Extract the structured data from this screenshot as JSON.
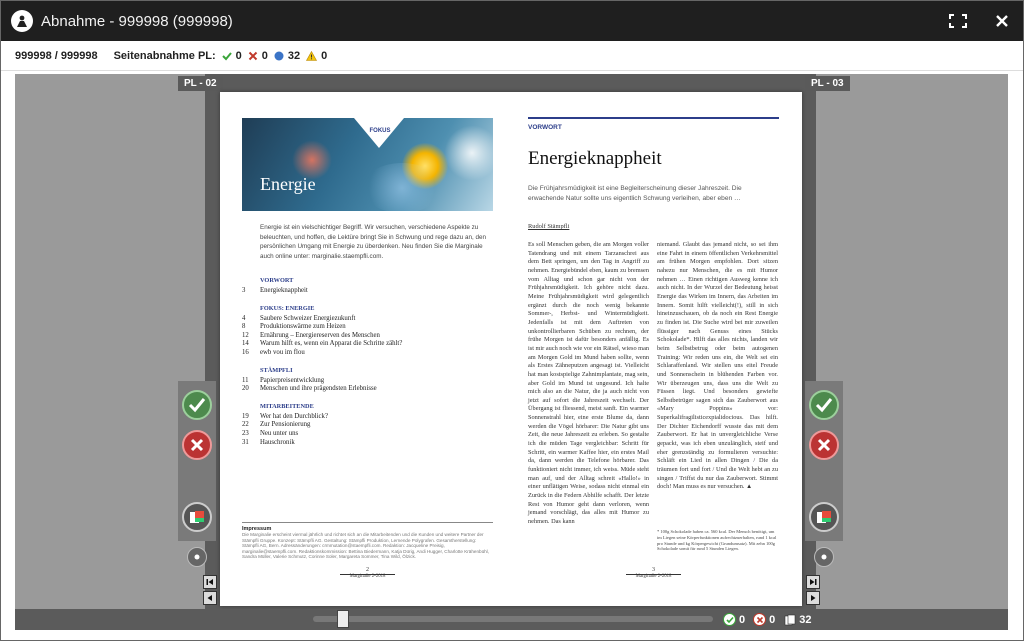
{
  "window": {
    "title": "Abnahme - 999998 (999998)"
  },
  "infobar": {
    "job_id": "999998 / 999998",
    "label": "Seitenabnahme PL:",
    "approved_count": "0",
    "rejected_count": "0",
    "pending_count": "32",
    "warning_count": "0"
  },
  "viewer": {
    "left_page_label": "PL - 02",
    "right_page_label": "PL - 03"
  },
  "bottombar": {
    "approved_count": "0",
    "rejected_count": "0",
    "pages_count": "32"
  },
  "colors": {
    "titlebar": "#1f1f1f",
    "approve_green": "#4caf50",
    "reject_red": "#d9534f",
    "accent_blue": "#2c3e8a"
  },
  "left_page": {
    "hero_tag": "FOKUS",
    "hero_title": "Energie",
    "intro": "Energie ist ein vielschichtiger Begriff. Wir versuchen, verschiedene Aspekte zu beleuchten, und hoffen, die Lektüre bringt Sie in Schwung und rege dazu an, den persönlichen Umgang mit Energie zu überdenken. Neu finden Sie die Marginale auch online unter: marginalie.staempfli.com.",
    "toc": [
      {
        "section": "VORWORT",
        "rows": [
          {
            "num": "3",
            "text": "Energieknappheit"
          }
        ]
      },
      {
        "section": "FOKUS: ENERGIE",
        "rows": [
          {
            "num": "4",
            "text": "Saubere Schweizer Energiezukunft"
          },
          {
            "num": "8",
            "text": "Produktionswärme zum Heizen"
          },
          {
            "num": "12",
            "text": "Ernährung – Energiereserven des Menschen"
          },
          {
            "num": "14",
            "text": "Warum hilft es, wenn ein Apparat die Schritte zählt?"
          },
          {
            "num": "16",
            "text": "ewb vou im flou"
          }
        ]
      },
      {
        "section": "STÄMPFLI",
        "rows": [
          {
            "num": "11",
            "text": "Papierpreisentwicklung"
          },
          {
            "num": "20",
            "text": "Menschen und ihre prägendsten Erlebnisse"
          }
        ]
      },
      {
        "section": "MITARBEITENDE",
        "rows": [
          {
            "num": "19",
            "text": "Wer hat den Durchblick?"
          },
          {
            "num": "22",
            "text": "Zur Pensionierung"
          },
          {
            "num": "23",
            "text": "Neu unter uns"
          },
          {
            "num": "31",
            "text": "Hauschronik"
          }
        ]
      }
    ],
    "impressum_title": "Impressum",
    "impressum_text": "Die Marginalie erscheint viermal jährlich und richtet sich an die Mitarbeitenden und die Kunden und weitere Partner der Stämpfli Gruppe. Konzept: Stämpfli AG. Gestaltung: Stämpfli Produktion, Lernende Polygrafen. Gesamtherstellung: Stämpfli AG, Bern. Adressänderungen: crmmutation@staempfli.com. Redaktion: Jacqueline Preisig, marginalie@staempfli.com. Redaktionskommission: Bettina Biedermann, Katja Dürig, Andi Hugger, Charlotte Krähenbühl, Sandra Müller, Valerie Schmutz, Corinne Soler, Margareta Sommer, Tina Wild, Ölzick.",
    "folio_num": "2",
    "folio_text": "Marginalie 2•2018"
  },
  "right_page": {
    "kicker": "VORWORT",
    "headline": "Energieknappheit",
    "lead": "Die Frühjahrsmüdigkeit ist eine Begleiterscheinung dieser Jahreszeit. Die erwachende Natur sollte uns eigentlich Schwung verleihen, aber eben …",
    "author": "Rudolf Stämpfli",
    "col1": "Es soll Menschen geben, die am Morgen voller Tatendrang und mit einem Tarzanschrei aus dem Bett springen, um den Tag in Angriff zu nehmen. Energiebündel eben, kaum zu bremsen vom Alltag und schon gar nicht von der Frühjahrsmüdigkeit. Ich gehöre nicht dazu. Meine Frühjahrsmüdigkeit wird gelegentlich ergänzt durch die noch wenig bekannte Sommer-, Herbst- und Wintermüdigkeit. Jedenfalls ist mit dem Auftreten von unkontrollierbaren Schüben zu rechnen, der frühe Morgen ist dafür besonders anfällig. Es ist mir auch noch wie vor ein Rätsel, wieso man am Morgen Gold im Mund haben sollte, wenn als Erstes Zähneputzen angesagt ist. Vielleicht hat man kostspielige Zahnimplantate, mag sein, aber Gold im Mund ist ungesund. Ich halte mich also an die Natur, die ja auch nicht von jetzt auf sofort die Jahreszeit wechselt. Der Übergang ist fliessend, meist sanft. Ein warmer Sonnenstrahl hier, eine erste Blume da, dann werden die Vögel hörbarer: Die Natur gibt uns Zeit, die neue Jahreszeit zu erleben. So gestalte ich die müden Tage vergleichbar: Schritt für Schritt, ein warmer Kaffee hier, ein erstes Mail da, dann werden die Telefone hörbarer. Das funktioniert nicht immer, ich weiss. Müde steht man auf, und der Alltag schreit «Hallo!» in einer unflätigen Weise, sodass nicht einmal ein Zurück in die Federn Abhilfe schafft. Der letzte Rest von Humor geht dann verloren, wenn jemand vorschlägt, das alles mit Humor zu nehmen. Das kann",
    "col2": "niemand. Glaubt das jemand nicht, so sei ihm eine Fahrt in einem öffentlichen Verkehrsmittel am frühen Morgen empfohlen. Dort sitzen nahezu nur Menschen, die es mit Humor nehmen … Einen richtigen Ausweg kenne ich auch nicht. In der Wurzel der Bedeutung heisst Energie das Wirken im Innern, das Arbeiten im Innern. Somit hilft vielleicht(!), still in sich hineinzuschauen, ob da noch ein Rest Energie zu finden ist. Die Suche wird bei mir zuweilen flüssiger nach Genuss eines Stücks Schokolade*. Hilft das alles nichts, landen wir beim Selbstbetrug oder beim autogenen Training: Wir reden uns ein, die Welt sei ein Schlaraffenland. Wir stellen uns eitel Freude und Sonnenschein in blühenden Farben vor. Wir überzeugen uns, dass uns die Welt zu Füssen liegt. Und besonders gewiefte Selbstbetrüger sagen sich das Zauberwort aus «Mary Poppins» vor: Superkalifragilisticexpialidocious. Das hilft. Der Dichter Eichendorff wusste das mit dem Zauberwort. Er hat in unvergleichliche Verse gepackt, was ich eben unzulänglich, steif und eher grenzständig zu formulieren versuchte: Schläft ein Lied in allen Dingen / Die da träumen fort und fort / Und die Welt hebt an zu singen / Triffst du nur das Zauberwort. Stimmt doch! Man muss es nur versuchen. ▲",
    "footnote": "* 100g Schokolade haben ca. 560 kcal. Der Mensch benötigt, um im Liegen seine Körperfunktionen aufrechtzuerhalten, rund 1 kcal pro Stunde und kg Körpergewicht (Grundumsatz). Mit zehn 100g Schokolade somit für rund 5 Stunden Liegen.",
    "folio_num": "3",
    "folio_text": "Marginalie 2•2018"
  }
}
